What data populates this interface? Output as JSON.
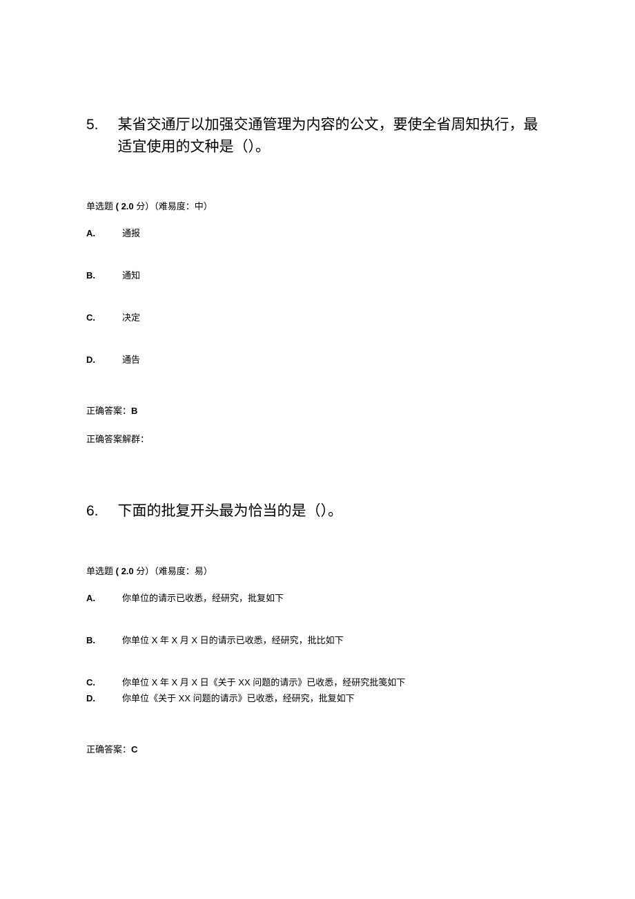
{
  "questions": [
    {
      "number": "5.",
      "text": "某省交通厅以加强交通管理为内容的公文，要使全省周知执行，最适宜使用的文种是（）。",
      "meta_prefix": "单选题",
      "meta_points": " ( 2.0 ",
      "meta_unit": "分）（难易度：中）",
      "options": [
        {
          "label": "A.",
          "text": "通报"
        },
        {
          "label": "B.",
          "text": "通知"
        },
        {
          "label": "C.",
          "text": "决定"
        },
        {
          "label": "D.",
          "text": "通告"
        }
      ],
      "answer_label": "正确答案：",
      "answer_value": "B",
      "explanation_label": "正确答案解群："
    },
    {
      "number": "6.",
      "text": "下面的批复开头最为恰当的是（）。",
      "meta_prefix": "单选题",
      "meta_points": " ( 2.0 ",
      "meta_unit": "分）（难易度：易）",
      "options": [
        {
          "label": "A.",
          "text": "你单位的请示已收悉，经研究，批复如下"
        },
        {
          "label": "B.",
          "text": "你单位 X 年 X 月 X 日的请示已收悉，经研究，批比如下"
        },
        {
          "label": "C.",
          "text": "你单位 X 年 X 月 X 日《关于 XX 问题的请示》已收悉，经研究批笺如下"
        },
        {
          "label": "D.",
          "text": "你单位《关于 XX 问题的请示》已收悉，经研究，批复如下"
        }
      ],
      "answer_label": "正确答案：",
      "answer_value": "C"
    }
  ]
}
